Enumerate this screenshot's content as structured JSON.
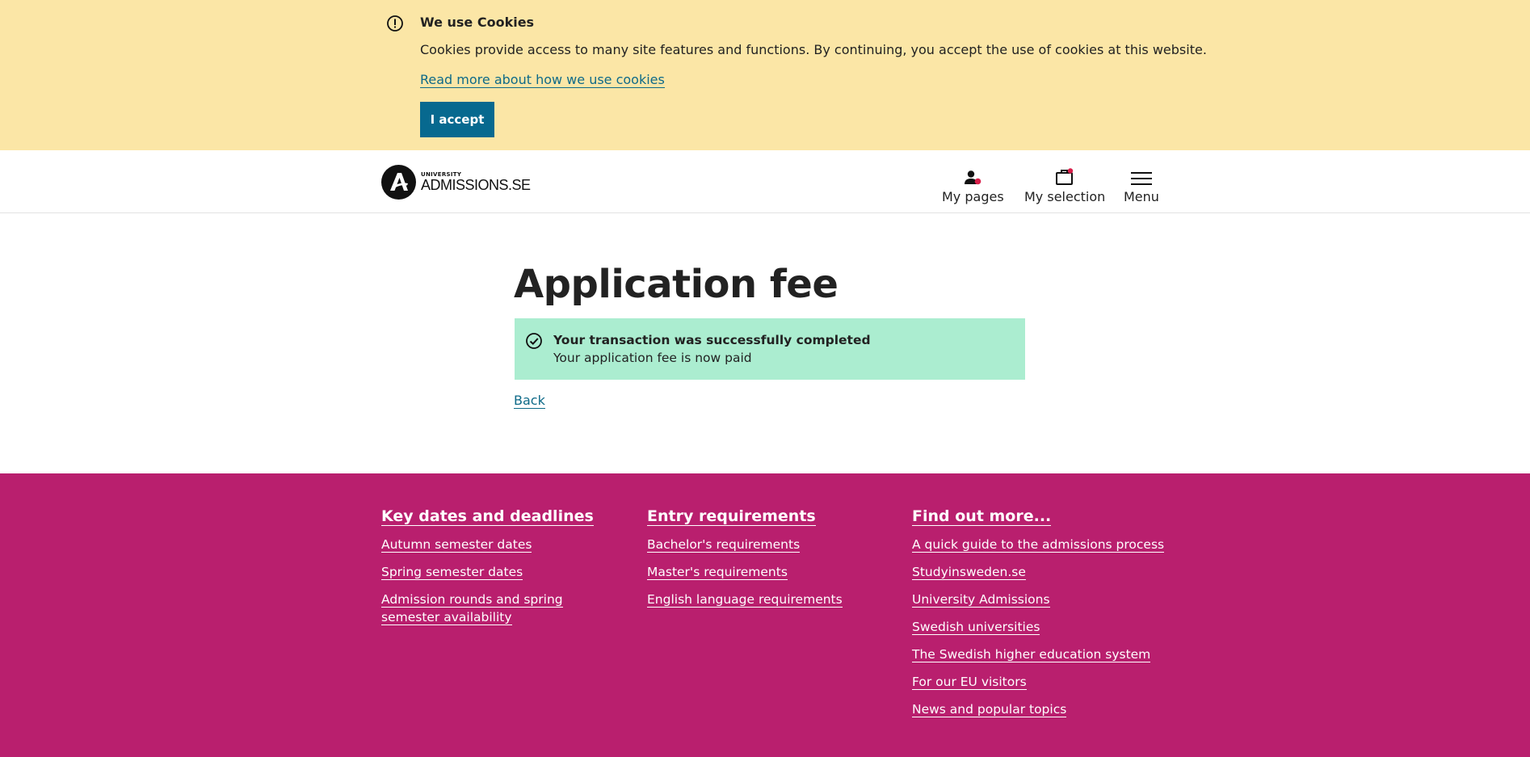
{
  "cookie_banner": {
    "title": "We use Cookies",
    "text": "Cookies provide access to many site features and functions. By continuing, you accept the use of cookies at this website.",
    "link": "Read more about how we use cookies",
    "accept_label": "I accept",
    "icon": "exclamation-circle-icon"
  },
  "header": {
    "logo_small": "UNIVERSITY",
    "logo_big": "ADMISSIONS.SE",
    "nav": {
      "my_pages": "My pages",
      "my_selection": "My selection",
      "menu": "Menu"
    }
  },
  "main": {
    "title": "Application fee",
    "alert": {
      "title": "Your transaction was successfully completed",
      "text": "Your application fee is now paid",
      "icon": "check-circle-icon"
    },
    "back_label": "Back"
  },
  "footer": {
    "columns": [
      {
        "heading": "Key dates and deadlines",
        "links": [
          "Autumn semester dates",
          "Spring semester dates",
          "Admission rounds and spring semester availability"
        ]
      },
      {
        "heading": "Entry requirements",
        "links": [
          "Bachelor's requirements",
          "Master's requirements",
          "English language requirements"
        ]
      },
      {
        "heading": "Find out more...",
        "links": [
          "A quick guide to the admissions process",
          "Studyinsweden.se",
          "University Admissions",
          "Swedish universities",
          "The Swedish higher education system",
          "For our EU visitors",
          "News and popular topics"
        ]
      }
    ]
  },
  "colors": {
    "cookie_bg": "#fbe6a6",
    "accent_blue": "#07698f",
    "success_bg": "#abedd0",
    "footer_bg": "#b91f6e",
    "notification_dot": "#d81f4a"
  }
}
